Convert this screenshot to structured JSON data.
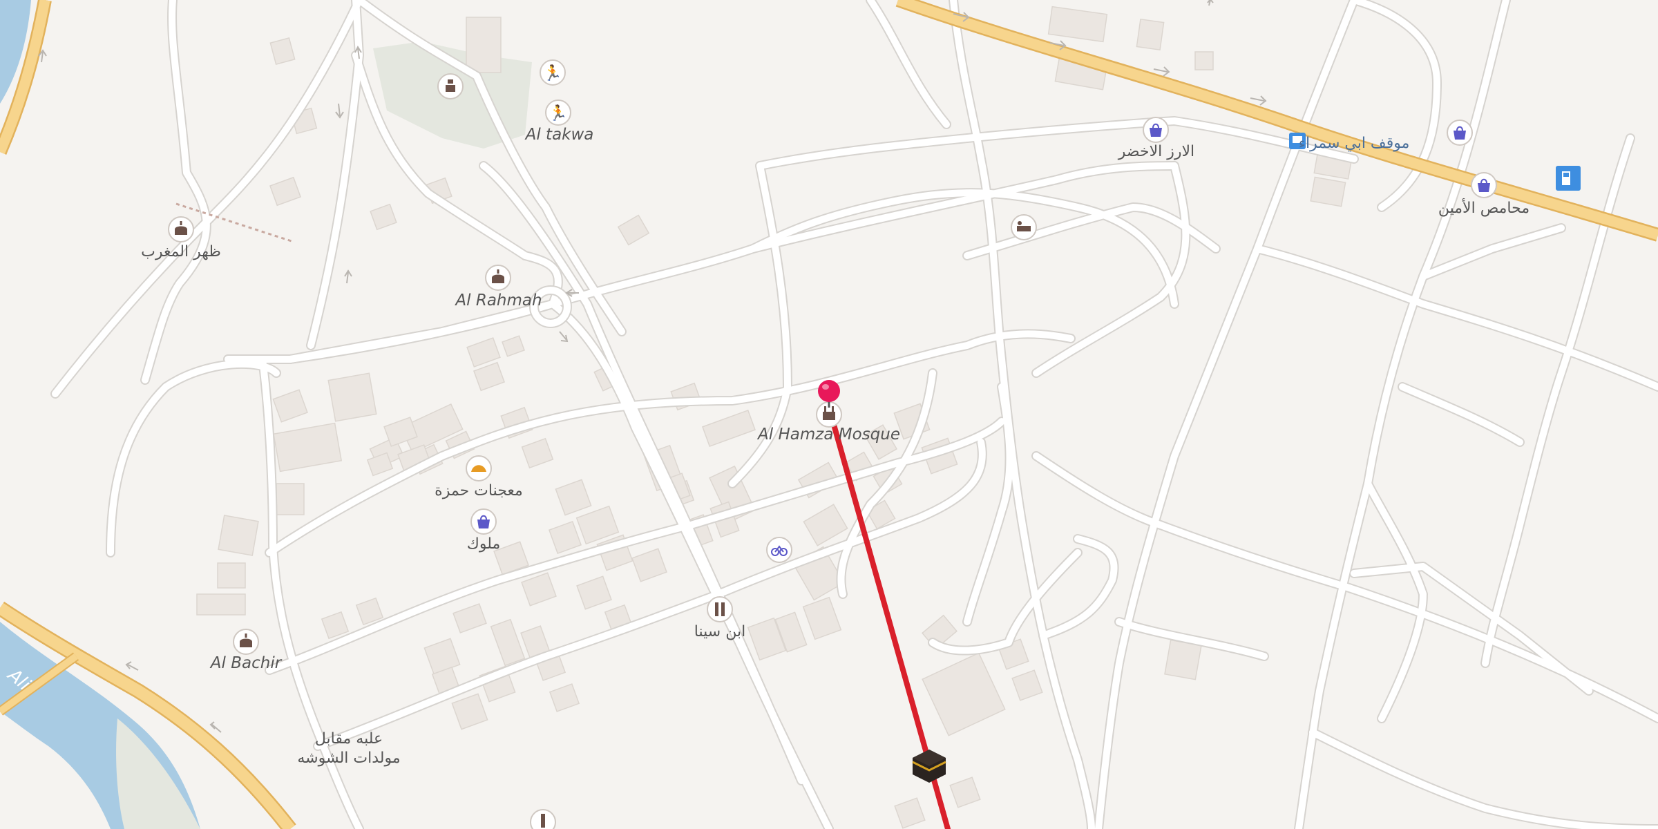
{
  "map": {
    "colors": {
      "background": "#f5f3f0",
      "road": "#ffffff",
      "road_casing": "#d6d3cf",
      "highway": "#f7d58d",
      "highway_casing": "#e2b25c",
      "water": "#a8cbe3",
      "park": "#e4e7df",
      "building": "#ebe6e1",
      "route_line": "#d9202b",
      "pin": "#e8185a"
    },
    "labels": {
      "al_takwa": "Al takwa",
      "al_rahmah": "Al Rahmah",
      "zohr_almaghrib": "ظهر المغرب",
      "al_hamza_mosque": "Al Hamza Mosque",
      "bakery_hamza": "معجنات حمزة",
      "malok": "ملوك",
      "ibn_sina": "ابن سينا",
      "al_bachir": "Al Bachir",
      "candy_line1": "علبه مقابل",
      "candy_line2": "مولدات الشوشه",
      "al_arz_green": "الارز الاخضر",
      "bus_stop": "موقف ابي سمراء",
      "al_amin_roastery": "محامص الأمين",
      "river": "Ali"
    },
    "icons": {
      "pin": "map-pin-icon",
      "kaaba": "kaaba-icon",
      "mosque": "mosque-icon",
      "shop": "shopping-bag-icon",
      "sport": "running-person-icon",
      "bakery": "croissant-icon",
      "bicycle": "bicycle-icon",
      "pharmacy": "pharmacy-icon",
      "hotel": "bed-icon",
      "bus": "bus-stop-icon",
      "fuel": "fuel-icon",
      "monument": "monument-icon"
    }
  }
}
